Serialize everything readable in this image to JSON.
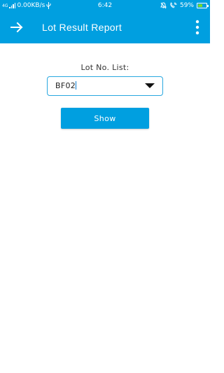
{
  "status_bar": {
    "network_label": "4G",
    "speed": "0.00KB/s",
    "time": "6:42",
    "battery": "59%",
    "battery_level": 59,
    "icons": [
      "signal-icon",
      "usb-icon",
      "silent-bell-icon",
      "wifi-call-icon",
      "battery-icon"
    ]
  },
  "app_bar": {
    "title": "Lot Result Report",
    "back_icon": "arrow-right-icon",
    "menu_icon": "more-vert-icon"
  },
  "form": {
    "lot_label": "Lot No. List:",
    "lot_selected": "BF02",
    "show_label": "Show"
  },
  "colors": {
    "primary": "#009fe0",
    "input_border": "#29a8e0",
    "background": "#ffffff"
  }
}
